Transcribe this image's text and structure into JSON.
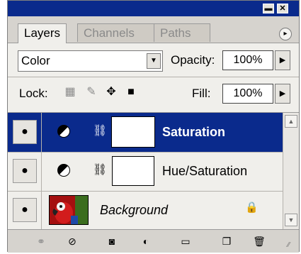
{
  "window": {
    "minimize_icon": "minimize-icon",
    "close_icon": "close-icon",
    "minimize_glyph": "▬",
    "close_glyph": "✕"
  },
  "tabs": [
    {
      "label": "Layers",
      "active": true
    },
    {
      "label": "Channels",
      "active": false
    },
    {
      "label": "Paths",
      "active": false
    }
  ],
  "panel_menu_icon": "▸",
  "options": {
    "blend_mode": "Color",
    "opacity_label": "Opacity:",
    "opacity_value": "100%",
    "lock_label": "Lock:",
    "fill_label": "Fill:",
    "fill_value": "100%"
  },
  "layers": [
    {
      "name": "Saturation",
      "selected": true,
      "type": "adjustment"
    },
    {
      "name": "Hue/Saturation",
      "selected": false,
      "type": "adjustment"
    },
    {
      "name": "Background",
      "selected": false,
      "type": "image",
      "locked": true
    }
  ],
  "colors": {
    "titlebar": "#0a2a8c",
    "selection": "#0a2a8c",
    "panel_bg": "#d6d3ce",
    "content_bg": "#f0efeb"
  }
}
